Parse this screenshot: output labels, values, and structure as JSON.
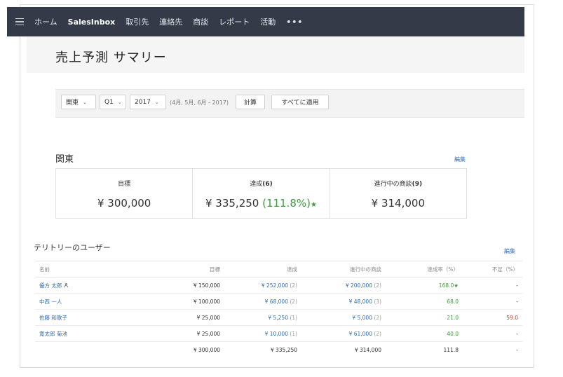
{
  "nav": {
    "items": [
      "ホーム",
      "SalesInbox",
      "取引先",
      "連絡先",
      "商談",
      "レポート",
      "活動"
    ],
    "more": "•••"
  },
  "page": {
    "title": "売上予測 サマリー"
  },
  "filters": {
    "region": "関東",
    "quarter": "Q1",
    "year": "2017",
    "range_text": "(4月, 5月, 6月 - 2017)",
    "calc_label": "計算",
    "apply_all_label": "すべてに適用"
  },
  "region_section": {
    "title": "関東",
    "edit_label": "編集",
    "target_label": "目標",
    "target_value": "¥ 300,000",
    "achieved_label": "達成",
    "achieved_count": "(6)",
    "achieved_value": "¥ 335,250",
    "achieved_pct": "(111.8%)",
    "achieved_star": "★",
    "inprogress_label": "進行中の商談",
    "inprogress_count": "(9)",
    "inprogress_value": "¥ 314,000"
  },
  "users_section": {
    "title": "テリトリーのユーザー",
    "edit_label": "編集",
    "columns": [
      "名前",
      "目標",
      "達成",
      "進行中の商談",
      "達成率（%）",
      "不足（%）"
    ],
    "rows": [
      {
        "name": "優方 太郎",
        "target": "¥ 150,000",
        "achieved": "¥ 252,000",
        "achieved_count": "(2)",
        "inprogress": "¥ 200,000",
        "inprogress_count": "(2)",
        "rate": "168.0★",
        "shortfall": "-"
      },
      {
        "name": "中西 一人",
        "target": "¥ 100,000",
        "achieved": "¥ 68,000",
        "achieved_count": "(2)",
        "inprogress": "¥ 48,000",
        "inprogress_count": "(3)",
        "rate": "68.0",
        "shortfall": "-"
      },
      {
        "name": "佐藤 和歌子",
        "target": "¥ 25,000",
        "achieved": "¥ 5,250",
        "achieved_count": "(1)",
        "inprogress": "¥ 5,000",
        "inprogress_count": "(2)",
        "rate": "21.0",
        "shortfall": "59.0"
      },
      {
        "name": "寛太郎 菊池",
        "target": "¥ 25,000",
        "achieved": "¥ 10,000",
        "achieved_count": "(1)",
        "inprogress": "¥ 61,000",
        "inprogress_count": "(2)",
        "rate": "40.0",
        "shortfall": "-"
      }
    ],
    "total": {
      "name": "",
      "target": "¥ 300,000",
      "achieved": "¥ 335,250",
      "inprogress": "¥ 314,000",
      "rate": "111.8",
      "shortfall": "-"
    }
  },
  "colors": {
    "nav_bg": "#343a48",
    "link": "#2f6db5",
    "positive": "#3e9a3e",
    "negative": "#c0392b"
  },
  "icons": {
    "menu": "hamburger-menu-icon",
    "user": "person-icon",
    "dropdown": "chevron-down-icon"
  }
}
